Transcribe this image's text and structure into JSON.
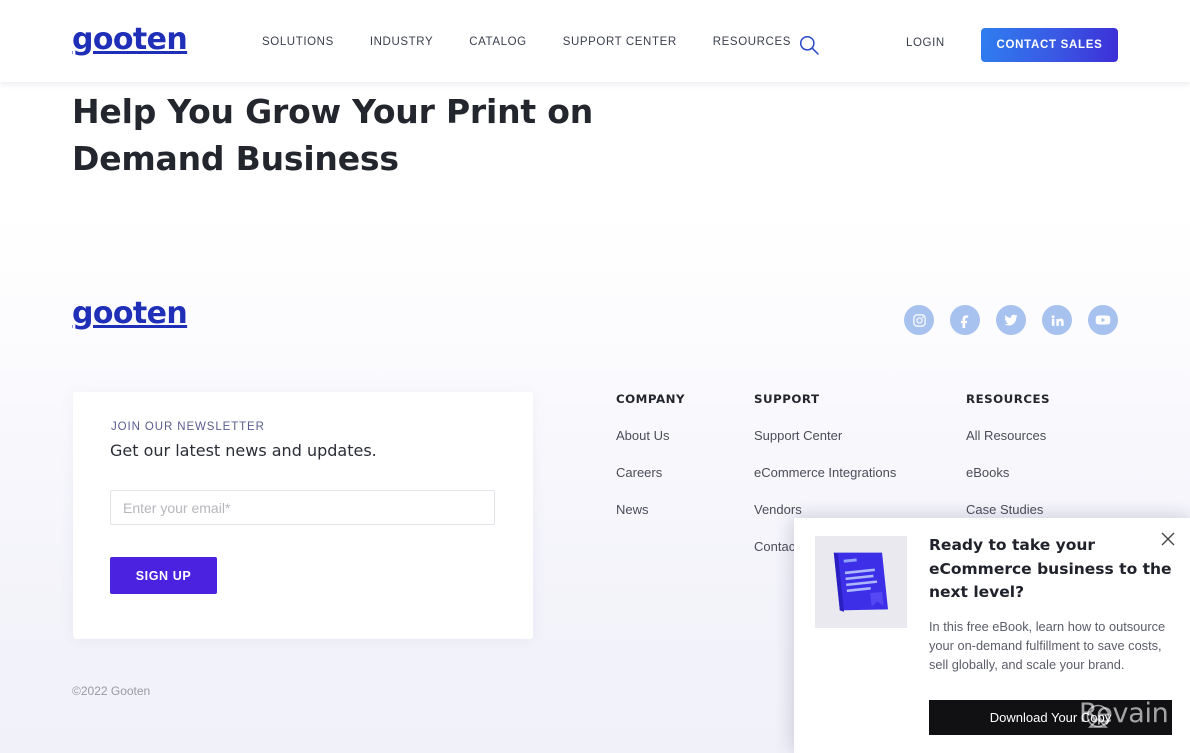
{
  "brand": {
    "name": "gooten",
    "color": "#1f2fb8"
  },
  "navbar": {
    "links": [
      {
        "label": "SOLUTIONS"
      },
      {
        "label": "INDUSTRY"
      },
      {
        "label": "CATALOG"
      },
      {
        "label": "SUPPORT CENTER"
      },
      {
        "label": "RESOURCES"
      }
    ],
    "search_icon": "search-icon",
    "login_label": "LOGIN",
    "cta_label": "CONTACT SALES",
    "cta_gradient_from": "#2e7ef0",
    "cta_gradient_to": "#3c2ed6"
  },
  "hero": {
    "title": "Help You Grow Your Print on Demand Business"
  },
  "footer": {
    "logo": "gooten",
    "socials": [
      {
        "name": "instagram-icon"
      },
      {
        "name": "facebook-icon"
      },
      {
        "name": "twitter-icon"
      },
      {
        "name": "linkedin-icon"
      },
      {
        "name": "youtube-icon"
      }
    ],
    "social_color": "#a8c2ef",
    "newsletter": {
      "kicker": "JOIN OUR NEWSLETTER",
      "title": "Get our latest news and updates.",
      "email_placeholder": "Enter your email*",
      "email_value": "",
      "submit_label": "SIGN UP",
      "submit_color": "#4a22e0"
    },
    "columns": [
      {
        "heading": "COMPANY",
        "links": [
          {
            "label": "About Us"
          },
          {
            "label": "Careers"
          },
          {
            "label": "News"
          }
        ]
      },
      {
        "heading": "SUPPORT",
        "links": [
          {
            "label": "Support Center"
          },
          {
            "label": "eCommerce Integrations"
          },
          {
            "label": "Vendors"
          },
          {
            "label": "Contact Us"
          }
        ]
      },
      {
        "heading": "RESOURCES",
        "links": [
          {
            "label": "All Resources"
          },
          {
            "label": "eBooks"
          },
          {
            "label": "Case Studies"
          }
        ]
      }
    ],
    "copyright": "©2022 Gooten"
  },
  "popup": {
    "close_icon": "close-icon",
    "book_image_alt": "ebook-cover-image",
    "title": "Ready to take your eCommerce business to the next level?",
    "body": "In this free eBook, learn how to outsource your on-demand fulfillment to save costs, sell globally, and scale your brand.",
    "cta_label": "Download Your Copy",
    "cta_color": "#111114"
  },
  "watermark": {
    "text": "Revain"
  }
}
